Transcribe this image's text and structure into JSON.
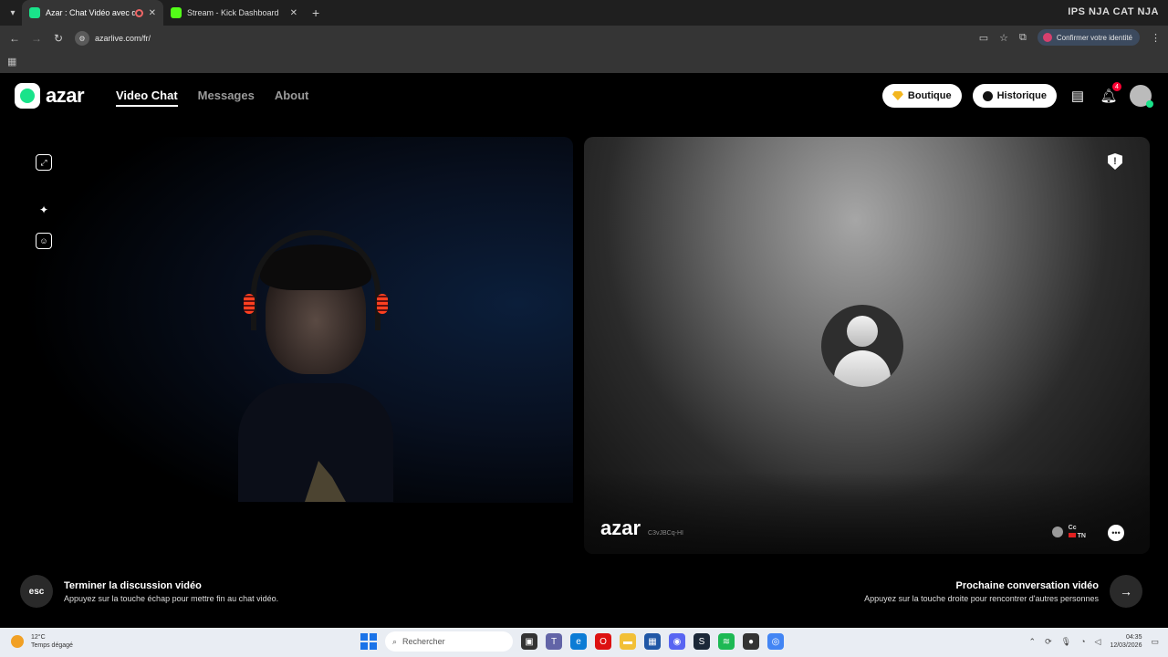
{
  "browser": {
    "tabs": [
      {
        "title": "Azar : Chat Vidéo avec de",
        "active": true,
        "favicon_color": "#19e38a"
      },
      {
        "title": "Stream - Kick Dashboard",
        "active": false,
        "favicon_color": "#53fc18"
      }
    ],
    "new_tab_icon": "plus-icon",
    "top_right_text": "IPS NJA  CAT NJA",
    "url": "azarlive.com/fr/",
    "confirm_identity": "Confirmer votre identité"
  },
  "app": {
    "logo_text": "azar",
    "nav": [
      {
        "label": "Video Chat",
        "active": true
      },
      {
        "label": "Messages",
        "active": false
      },
      {
        "label": "About",
        "active": false
      }
    ],
    "shop_label": "Boutique",
    "history_label": "Historique",
    "notification_count": "4",
    "brand_color": "#19e38a"
  },
  "peer": {
    "watermark": "azar",
    "session_id": "C3vJBCq-HI",
    "name": "Cc",
    "country": "TN"
  },
  "actions": {
    "end_key": "esc",
    "end_title": "Terminer la discussion vidéo",
    "end_sub": "Appuyez sur la touche échap pour mettre fin au chat vidéo.",
    "next_title": "Prochaine conversation vidéo",
    "next_sub": "Appuyez sur la touche droite pour rencontrer d'autres personnes",
    "next_icon": "arrow-right-icon"
  },
  "taskbar": {
    "temperature": "12°C",
    "weather": "Temps dégagé",
    "search_placeholder": "Rechercher",
    "time": "04:35",
    "date": "12/03/2026"
  }
}
